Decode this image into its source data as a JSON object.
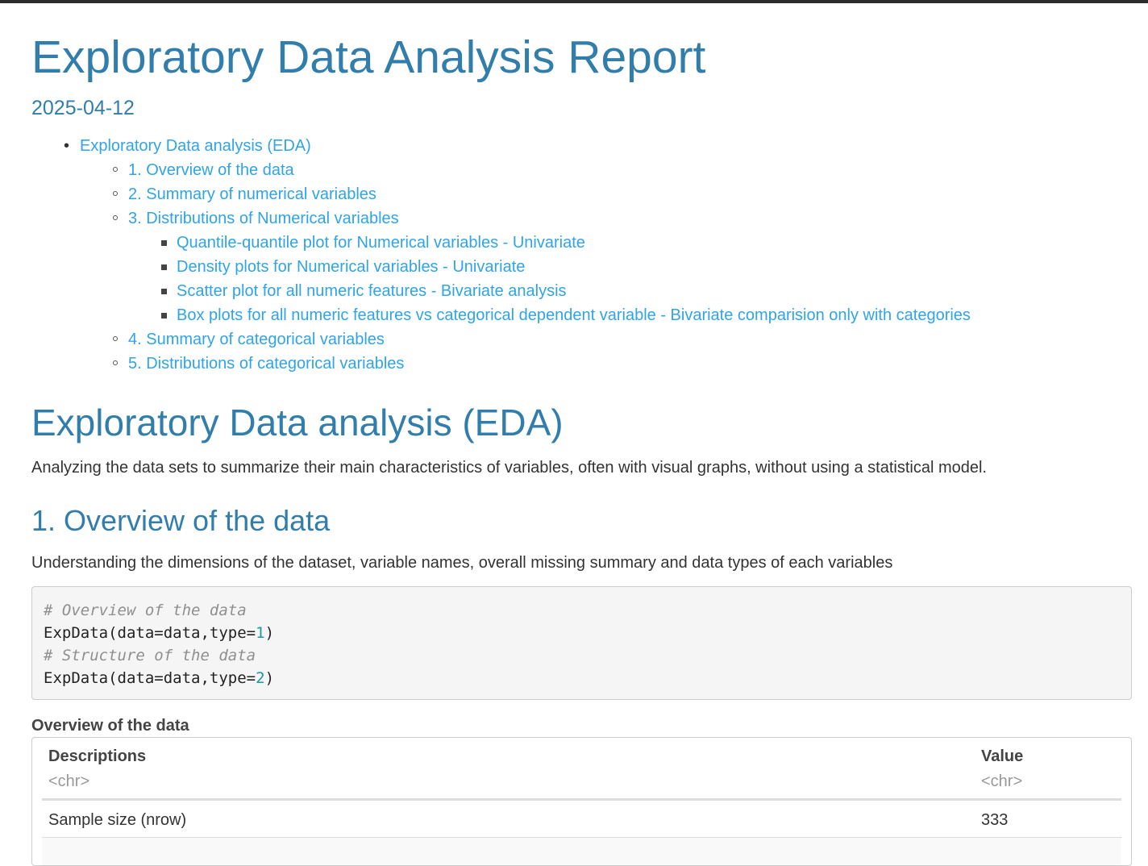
{
  "report": {
    "title": "Exploratory Data Analysis Report",
    "date": "2025-04-12"
  },
  "toc": [
    {
      "level": 1,
      "label": "Exploratory Data analysis (EDA)"
    },
    {
      "level": 2,
      "label": "1. Overview of the data"
    },
    {
      "level": 2,
      "label": "2. Summary of numerical variables"
    },
    {
      "level": 2,
      "label": "3. Distributions of Numerical variables"
    },
    {
      "level": 3,
      "label": "Quantile-quantile plot for Numerical variables - Univariate"
    },
    {
      "level": 3,
      "label": "Density plots for Numerical variables - Univariate"
    },
    {
      "level": 3,
      "label": "Scatter plot for all numeric features - Bivariate analysis"
    },
    {
      "level": 3,
      "label": "Box plots for all numeric features vs categorical dependent variable - Bivariate comparision only with categories"
    },
    {
      "level": 2,
      "label": "4. Summary of categorical variables"
    },
    {
      "level": 2,
      "label": "5. Distributions of categorical variables"
    }
  ],
  "section_eda": {
    "heading": "Exploratory Data analysis (EDA)",
    "text": "Analyzing the data sets to summarize their main characteristics of variables, often with visual graphs, without using a statistical model."
  },
  "section_overview": {
    "heading": "1. Overview of the data",
    "text": "Understanding the dimensions of the dataset, variable names, overall missing summary and data types of each variables"
  },
  "code": {
    "comment1": "# Overview of the data",
    "call1_prefix": "ExpData(data=data,type=",
    "call1_arg": "1",
    "call1_suffix": ")",
    "comment2": "# Structure of the data",
    "call2_prefix": "ExpData(data=data,type=",
    "call2_arg": "2",
    "call2_suffix": ")"
  },
  "table": {
    "caption": "Overview of the data",
    "columns": [
      {
        "header": "Descriptions",
        "type": "<chr>"
      },
      {
        "header": "Value",
        "type": "<chr>"
      }
    ],
    "rows": [
      [
        "Sample size (nrow)",
        "333"
      ]
    ]
  }
}
